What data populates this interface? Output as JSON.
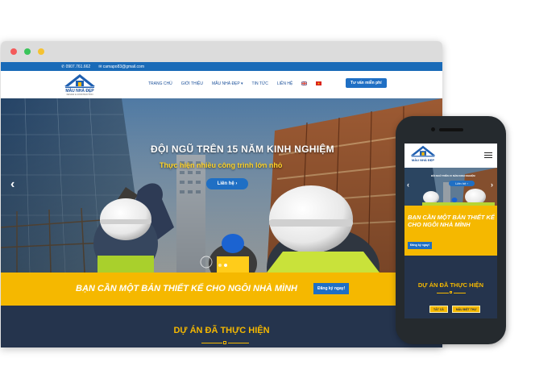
{
  "desktop": {
    "topbar": {
      "phone": "0907.761.662",
      "email": "camapo83@gmail.com"
    },
    "logo": {
      "name": "MẪU NHÀ ĐẸP",
      "tagline": "DESIGN & CONSTRUCTION"
    },
    "nav": {
      "items": [
        "TRANG CHỦ",
        "GIỚI THIỆU",
        "MẪU NHÀ ĐẸP",
        "TIN TỨC",
        "LIÊN HỆ"
      ],
      "cta": "Tư vấn miễn phí"
    },
    "hero": {
      "title": "ĐỘI NGŨ TRÊN 15 NĂM KINH NGHIỆM",
      "subtitle": "Thực hiện nhiều công trình lớn nhỏ",
      "button": "Liên hệ",
      "prev": "‹",
      "next": "›"
    },
    "banner": {
      "text": "BẠN CẦN MỘT BẢN THIẾT KẾ CHO NGÔI NHÀ MÌNH",
      "button": "Đăng ký ngay!"
    },
    "projects": {
      "title": "DỰ ÁN ĐÃ THỰC HIỆN"
    }
  },
  "mobile": {
    "logo": {
      "name": "MẪU NHÀ ĐẸP"
    },
    "hero": {
      "title": "ĐỘI NGŨ TRÊN 15 NĂM KINH NGHIỆM",
      "button": "Liên hệ",
      "prev": "‹",
      "next": "›"
    },
    "banner": {
      "text": "BẠN CẦN MỘT BẢN THIẾT KẾ CHO NGÔI NHÀ MÌNH",
      "button": "Đăng ký ngay!"
    },
    "projects": {
      "title": "DỰ ÁN ĐÃ THỰC HIỆN",
      "filters": [
        "TẤT CẢ",
        "MẪU BIỆT THỰ"
      ]
    }
  },
  "colors": {
    "primary": "#1f6fc4",
    "accent": "#f5b800",
    "dark": "#25344d",
    "topbar": "#1a6bb8"
  },
  "icons": {
    "window_controls": [
      "close-dot",
      "minimize-dot",
      "maximize-dot"
    ],
    "phone": "phone-icon",
    "email": "mail-icon",
    "menu": "hamburger-icon"
  }
}
